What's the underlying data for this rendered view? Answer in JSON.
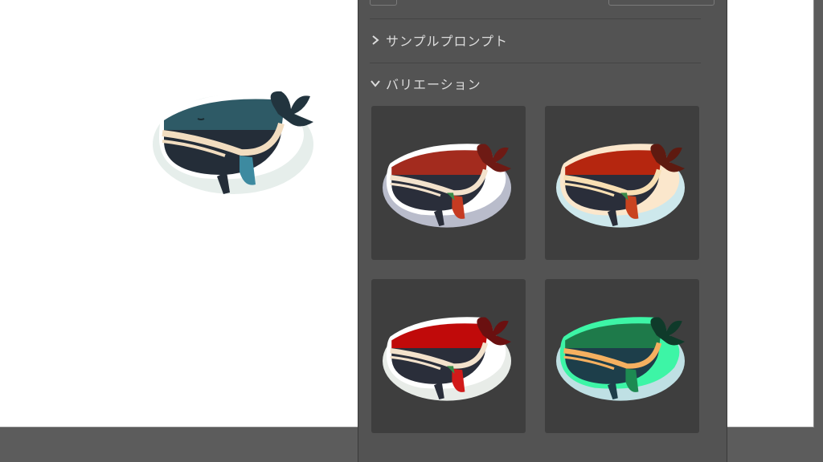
{
  "sections": {
    "sample_prompts": {
      "label": "サンプルプロンプト",
      "icon": "chevron-right-icon",
      "expanded": false
    },
    "variations": {
      "label": "バリエーション",
      "icon": "chevron-down-icon",
      "expanded": true
    }
  },
  "main_whale": {
    "icon": "whale-illustration",
    "body": "#2e5a66",
    "belly": "#242d38",
    "stripe": "#f2ddc0",
    "fin": "#3d8aa0",
    "halo": "#e6eeeb"
  },
  "variations": [
    {
      "name": "variation-1",
      "body": "#a32b1e",
      "belly": "#2a2e3a",
      "stripe": "#f3e2cc",
      "fin": "#c63b22",
      "halo": "#b9bccb",
      "outline": "#ffffff"
    },
    {
      "name": "variation-2",
      "body": "#b5260f",
      "belly": "#2a2e3a",
      "stripe": "#f8dfb3",
      "fin": "#c9431f",
      "halo": "#cde8ec",
      "outline": "#fbe7cc"
    },
    {
      "name": "variation-3",
      "body": "#c00a0a",
      "belly": "#2a2e3a",
      "stripe": "#f3e2cc",
      "fin": "#d11a1a",
      "halo": "#e8ece8",
      "outline": "#ffffff"
    },
    {
      "name": "variation-4",
      "body": "#1e7a4a",
      "belly": "#1d3e4a",
      "stripe": "#f5b060",
      "fin": "#1d8a52",
      "halo": "#bfe0e4",
      "outline": "#3df5a6"
    }
  ]
}
